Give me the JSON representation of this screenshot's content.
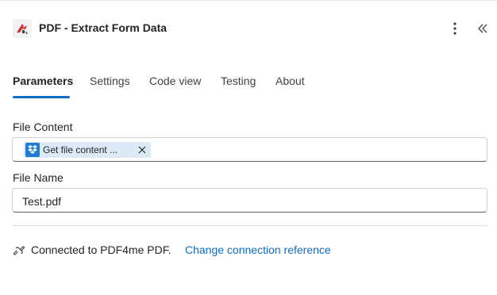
{
  "header": {
    "title": "PDF - Extract Form Data",
    "app_icon": "pdf4me-logo",
    "more_icon": "more-vertical-icon",
    "collapse_icon": "double-chevron-left-icon"
  },
  "tabs": [
    {
      "label": "Parameters",
      "active": true
    },
    {
      "label": "Settings",
      "active": false
    },
    {
      "label": "Code view",
      "active": false
    },
    {
      "label": "Testing",
      "active": false
    },
    {
      "label": "About",
      "active": false
    }
  ],
  "fields": {
    "file_content": {
      "label": "File Content",
      "token": {
        "text": "Get file content ...",
        "icon": "dropbox-icon"
      }
    },
    "file_name": {
      "label": "File Name",
      "value": "Test.pdf"
    }
  },
  "connection": {
    "text": "Connected to PDF4me PDF.",
    "link": "Change connection reference",
    "icon": "link-icon"
  },
  "colors": {
    "accent": "#0f6cbd",
    "token_bg": "#dce9f7",
    "dropbox": "#1e7cd6",
    "logo_red": "#d13438"
  }
}
